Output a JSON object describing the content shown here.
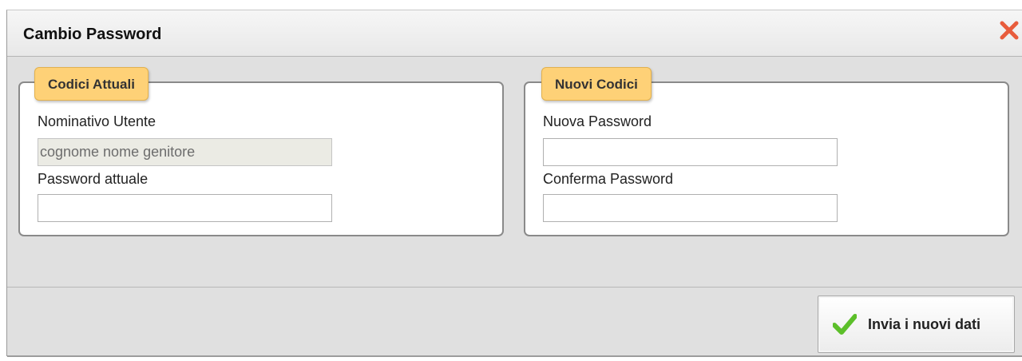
{
  "dialog": {
    "title": "Cambio Password",
    "close_icon": "close-x-icon",
    "accent_close": "#e85c3c"
  },
  "current_codes": {
    "legend": "Codici Attuali",
    "username_label": "Nominativo Utente",
    "username_value": "cognome nome genitore",
    "password_label": "Password attuale",
    "password_value": ""
  },
  "new_codes": {
    "legend": "Nuovi Codici",
    "new_password_label": "Nuova Password",
    "new_password_value": "",
    "confirm_password_label": "Conferma Password",
    "confirm_password_value": ""
  },
  "footer": {
    "submit_label": "Invia i nuovi dati",
    "submit_icon": "checkmark-icon",
    "accent_check": "#5cbf2a"
  },
  "colors": {
    "legend_bg": "#fed177",
    "panel_bg": "#e0e0e0"
  }
}
